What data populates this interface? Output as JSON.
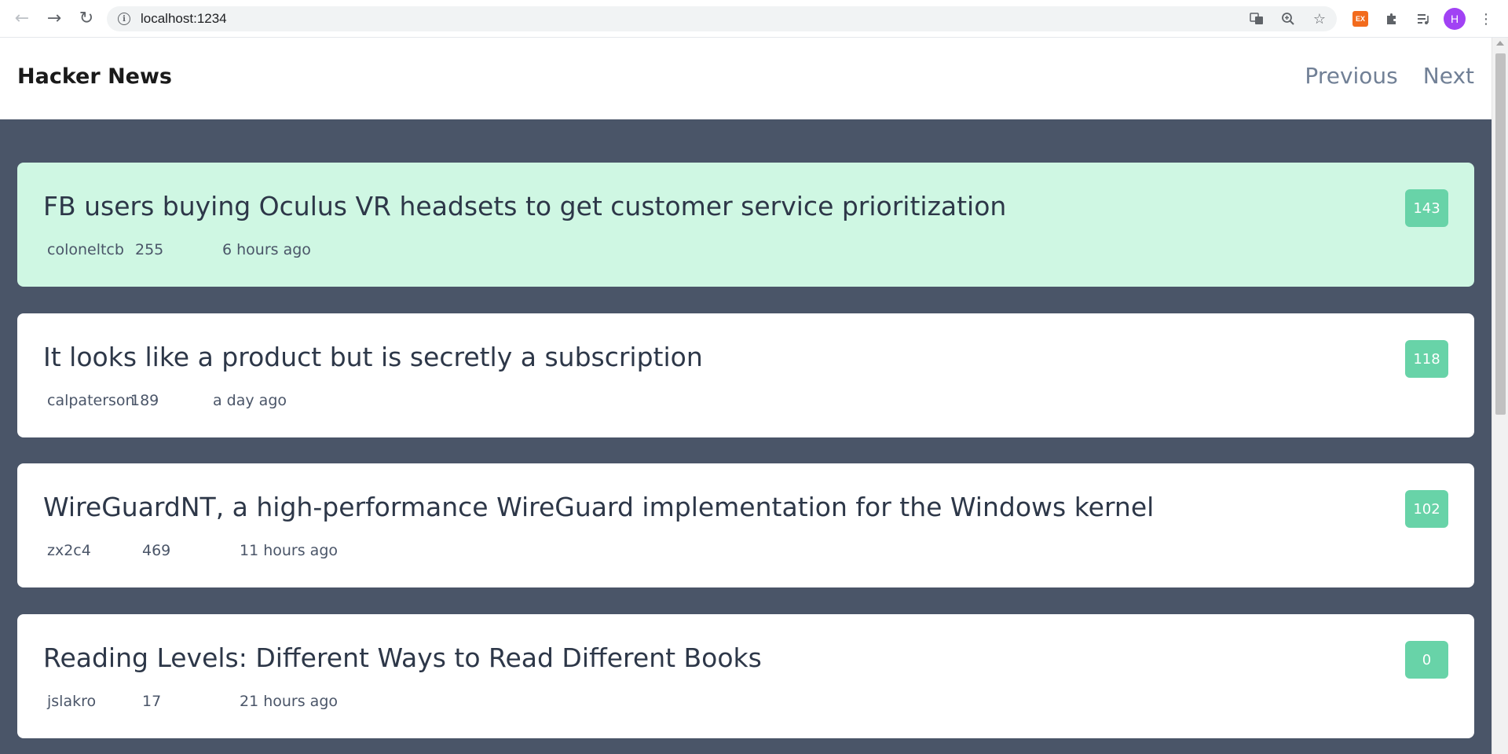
{
  "browser": {
    "url": "localhost:1234",
    "profile_initial": "H",
    "ext_label": "EX",
    "icons": {
      "back": "arrow-left-icon",
      "forward": "arrow-right-icon",
      "reload": "reload-icon",
      "info": "info-icon",
      "translate": "translate-icon",
      "zoom": "zoom-icon",
      "bookmark": "star-icon",
      "extensions": "puzzle-icon",
      "media": "media-queue-icon",
      "menu": "kebab-menu-icon"
    },
    "ext_color": "#f26b1d",
    "avatar_color": "#a142f4"
  },
  "app": {
    "brand": "Hacker News",
    "pager": {
      "previous": "Previous",
      "next": "Next"
    }
  },
  "stories": [
    {
      "title": "FB users buying Oculus VR headsets to get customer service prioritization",
      "author": "coloneltcb",
      "points": "255",
      "time": "6 hours ago",
      "comments": "143",
      "active": true
    },
    {
      "title": "It looks like a product but is secretly a subscription",
      "author": "calpaterson",
      "points": "189",
      "time": "a day ago",
      "comments": "118",
      "active": false
    },
    {
      "title": "WireGuardNT, a high-performance WireGuard implementation for the Windows kernel",
      "author": "zx2c4",
      "points": "469",
      "time": "11 hours ago",
      "comments": "102",
      "active": false
    },
    {
      "title": "Reading Levels: Different Ways to Read Different Books",
      "author": "jslakro",
      "points": "17",
      "time": "21 hours ago",
      "comments": "0",
      "active": false
    }
  ],
  "colors": {
    "page_bg": "#4a5568",
    "active_card": "#cff7e3",
    "badge": "#68d3a8",
    "title_text": "#2d3748",
    "pager_text": "#718096"
  }
}
